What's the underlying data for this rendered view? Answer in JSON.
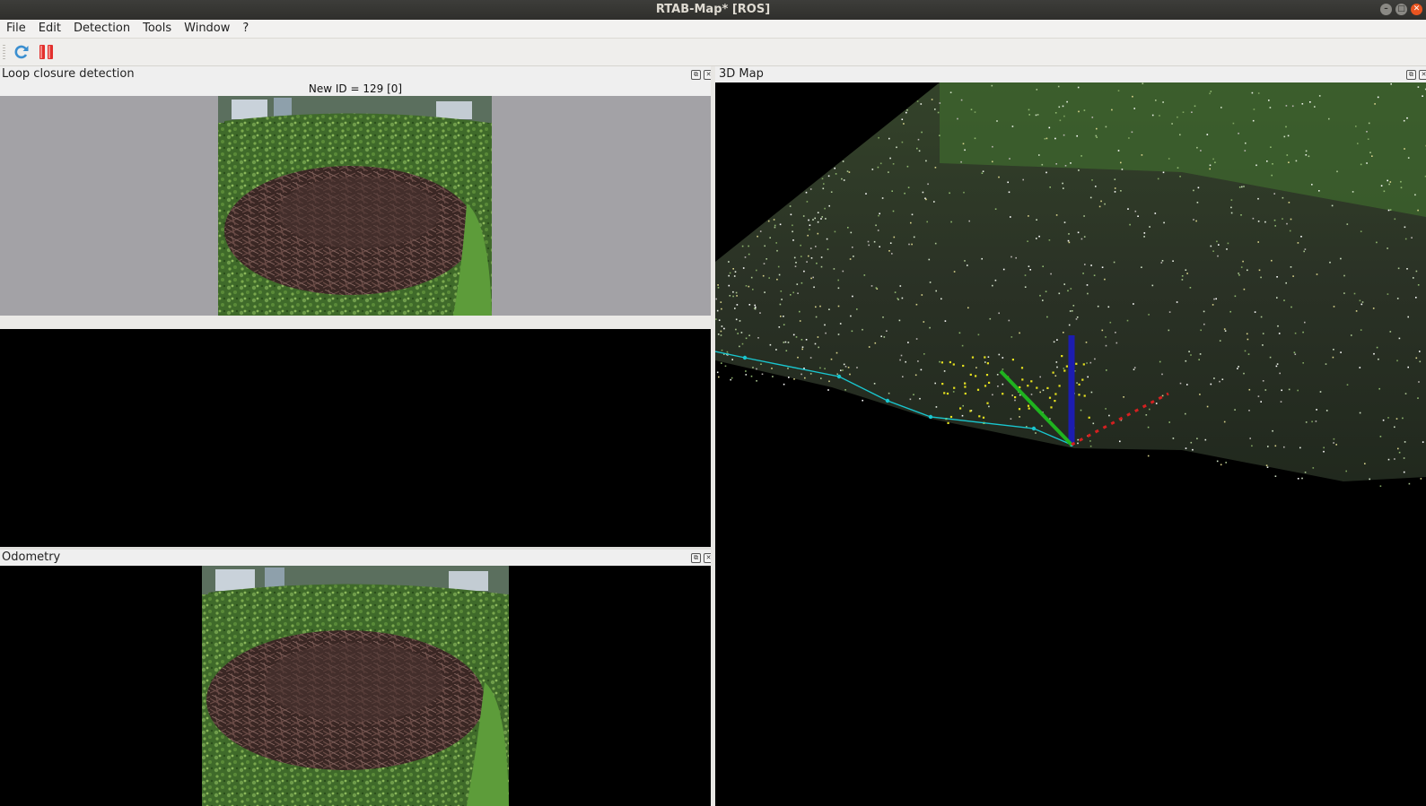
{
  "window": {
    "title": "RTAB-Map* [ROS]",
    "controls": [
      "minimize-icon",
      "maximize-icon",
      "close-icon"
    ]
  },
  "menu": {
    "items": [
      "File",
      "Edit",
      "Detection",
      "Tools",
      "Window",
      "?"
    ]
  },
  "toolbar": {
    "buttons": [
      "refresh-icon",
      "pause-icon"
    ]
  },
  "loop_closure": {
    "title": "Loop closure detection",
    "new_id_label": "New ID = 129 [0]"
  },
  "odometry": {
    "title": "Odometry"
  },
  "map3d": {
    "title": "3D Map",
    "trajectory_color": "#19c6cf",
    "axis_colors": {
      "x": "#d42020",
      "y": "#1fb31f",
      "z": "#1c1cb0"
    }
  },
  "colors": {
    "loop_bg": "#a3a2a6",
    "view_bg": "#000000",
    "titlebar_bg": "#3a3a37",
    "close_button": "#e95420"
  }
}
